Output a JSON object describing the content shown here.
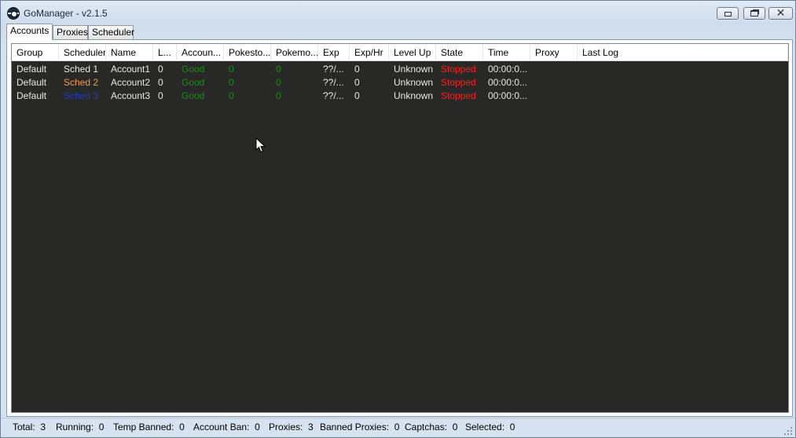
{
  "window": {
    "title": "GoManager - v2.1.5"
  },
  "tabs": [
    {
      "label": "Accounts",
      "active": true
    },
    {
      "label": "Proxies",
      "active": false
    },
    {
      "label": "Scheduler",
      "active": false
    }
  ],
  "accounts_table": {
    "columns": [
      "Group",
      "Scheduler",
      "Name",
      "L...",
      "Accoun...",
      "Pokesto...",
      "Pokemo...",
      "Exp",
      "Exp/Hr",
      "Level Up",
      "State",
      "Time",
      "Proxy",
      "Last Log"
    ],
    "rows": [
      [
        "Default",
        "Sched 1",
        "Account1",
        "0",
        "Good",
        "0",
        "0",
        "??/...",
        "0",
        "Unknown",
        "Stopped",
        "00:00:0...",
        "",
        ""
      ],
      [
        "Default",
        "Sched 2",
        "Account2",
        "0",
        "Good",
        "0",
        "0",
        "??/...",
        "0",
        "Unknown",
        "Stopped",
        "00:00:0...",
        "",
        ""
      ],
      [
        "Default",
        "Sched 3",
        "Account3",
        "0",
        "Good",
        "0",
        "0",
        "??/...",
        "0",
        "Unknown",
        "Stopped",
        "00:00:0...",
        "",
        ""
      ]
    ],
    "scheduler_colors": [
      "#e8e8e8",
      "#f2a040",
      "#1d3fc9"
    ],
    "colors": {
      "background": "#282826",
      "good": "#1e8a1e",
      "stopped": "#ff1e1e"
    }
  },
  "status": {
    "total_label": "Total:",
    "total": "3",
    "running_label": "Running:",
    "running": "0",
    "temp_banned_label": "Temp Banned:",
    "temp_banned": "0",
    "account_ban_label": "Account Ban:",
    "account_ban": "0",
    "proxies_label": "Proxies:",
    "proxies": "3",
    "banned_proxies_label": "Banned Proxies:",
    "banned_proxies": "0",
    "captchas_label": "Captchas:",
    "captchas": "0",
    "selected_label": "Selected:",
    "selected": "0"
  }
}
